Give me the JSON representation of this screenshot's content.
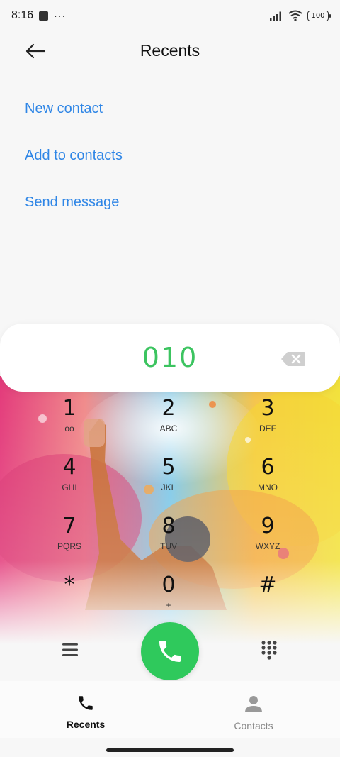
{
  "status_bar": {
    "time": "8:16",
    "overflow_indicator": "···",
    "battery_level": "100",
    "icons": [
      "notification-square-icon",
      "signal-icon",
      "wifi-icon",
      "battery-icon"
    ]
  },
  "header": {
    "title": "Recents",
    "back_icon": "arrow-left-icon"
  },
  "actions": [
    {
      "label": "New contact"
    },
    {
      "label": "Add to contacts"
    },
    {
      "label": "Send message"
    }
  ],
  "dialer": {
    "number": "010",
    "backspace_icon": "backspace-icon",
    "keys": [
      {
        "digit": "1",
        "letters": "ᴏᴏ"
      },
      {
        "digit": "2",
        "letters": "ABC"
      },
      {
        "digit": "3",
        "letters": "DEF"
      },
      {
        "digit": "4",
        "letters": "GHI"
      },
      {
        "digit": "5",
        "letters": "JKL"
      },
      {
        "digit": "6",
        "letters": "MNO"
      },
      {
        "digit": "7",
        "letters": "PQRS"
      },
      {
        "digit": "8",
        "letters": "TUV"
      },
      {
        "digit": "9",
        "letters": "WXYZ"
      },
      {
        "digit": "*",
        "letters": ""
      },
      {
        "digit": "0",
        "letters": "+"
      },
      {
        "digit": "#",
        "letters": ""
      }
    ],
    "menu_icon": "menu-icon",
    "call_icon": "phone-icon",
    "keypad_icon": "dialpad-icon"
  },
  "bottom_nav": {
    "items": [
      {
        "label": "Recents",
        "icon": "phone-icon",
        "active": true
      },
      {
        "label": "Contacts",
        "icon": "person-icon",
        "active": false
      }
    ]
  },
  "colors": {
    "accent_link": "#2f86e6",
    "dialed_number": "#3cc460",
    "call_button": "#2fc95c"
  }
}
